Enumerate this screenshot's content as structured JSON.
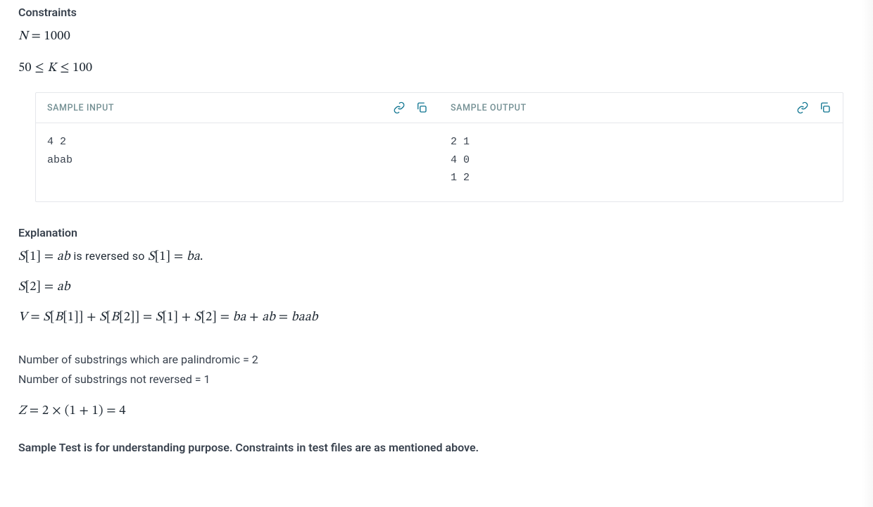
{
  "constraints": {
    "heading": "Constraints",
    "line1_html": "<span class='var'>N</span> = 1000",
    "line2_html": "50 ≤ <span class='var'>K</span> ≤ 100"
  },
  "samples": {
    "input": {
      "title": "SAMPLE INPUT",
      "body": "4 2\nabab"
    },
    "output": {
      "title": "SAMPLE OUTPUT",
      "body": "2 1\n4 0\n1 2"
    }
  },
  "explanation": {
    "heading": "Explanation",
    "line1_html": "<span class='var'>S</span>[1] = <span class='var'>ab</span> <span style='font-family:-apple-system,BlinkMacSystemFont,Segoe UI,Roboto,Arial,sans-serif;font-size:16px;font-style:normal;'>is reversed so</span> <span class='var'>S</span>[1] = <span class='var'>ba</span>.",
    "line2_html": "<span class='var'>S</span>[2] = <span class='var'>ab</span>",
    "line3_html": "<span class='var'>V</span> = <span class='var'>S</span>[<span class='var'>B</span>[1]] + <span class='var'>S</span>[<span class='var'>B</span>[2]] = <span class='var'>S</span>[1] + <span class='var'>S</span>[2] = <span class='var'>ba</span> + <span class='var'>ab</span> = <span class='var'>baab</span>",
    "palindromic": "Number of substrings which are palindromic = 2",
    "not_reversed": "Number of substrings not reversed = 1",
    "z_line_html": "<span class='var'>Z</span> = 2 × (1 + 1) = 4",
    "note": "Sample Test is for understanding purpose. Constraints in test files are as mentioned above."
  }
}
